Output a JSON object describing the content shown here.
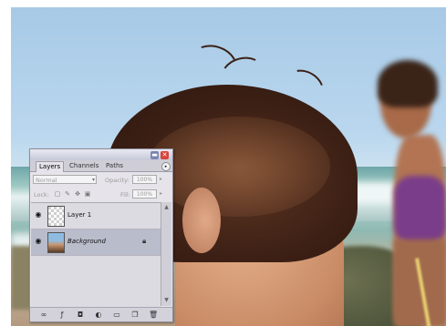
{
  "panel": {
    "tabs": [
      {
        "label": "Layers"
      },
      {
        "label": "Channels"
      },
      {
        "label": "Paths"
      }
    ],
    "blend_mode": "Normal",
    "opacity_label": "Opacity:",
    "opacity_value": "100%",
    "lock_label": "Lock:",
    "fill_label": "Fill:",
    "fill_value": "100%",
    "layers": [
      {
        "name": "Layer 1",
        "visible": true,
        "selected": false
      },
      {
        "name": "Background",
        "visible": true,
        "selected": true,
        "locked": true
      }
    ],
    "icons": {
      "minimize": "minimize-icon",
      "close": "close-icon",
      "menu": "panel-menu-icon",
      "lock_transparent": "lock-transparent-icon",
      "lock_paint": "lock-paint-icon",
      "lock_move": "lock-move-icon",
      "lock_all": "lock-all-icon",
      "bottom": [
        "link-layers-icon",
        "layer-style-icon",
        "layer-mask-icon",
        "adjustment-layer-icon",
        "new-group-icon",
        "new-layer-icon",
        "delete-layer-icon"
      ]
    }
  }
}
